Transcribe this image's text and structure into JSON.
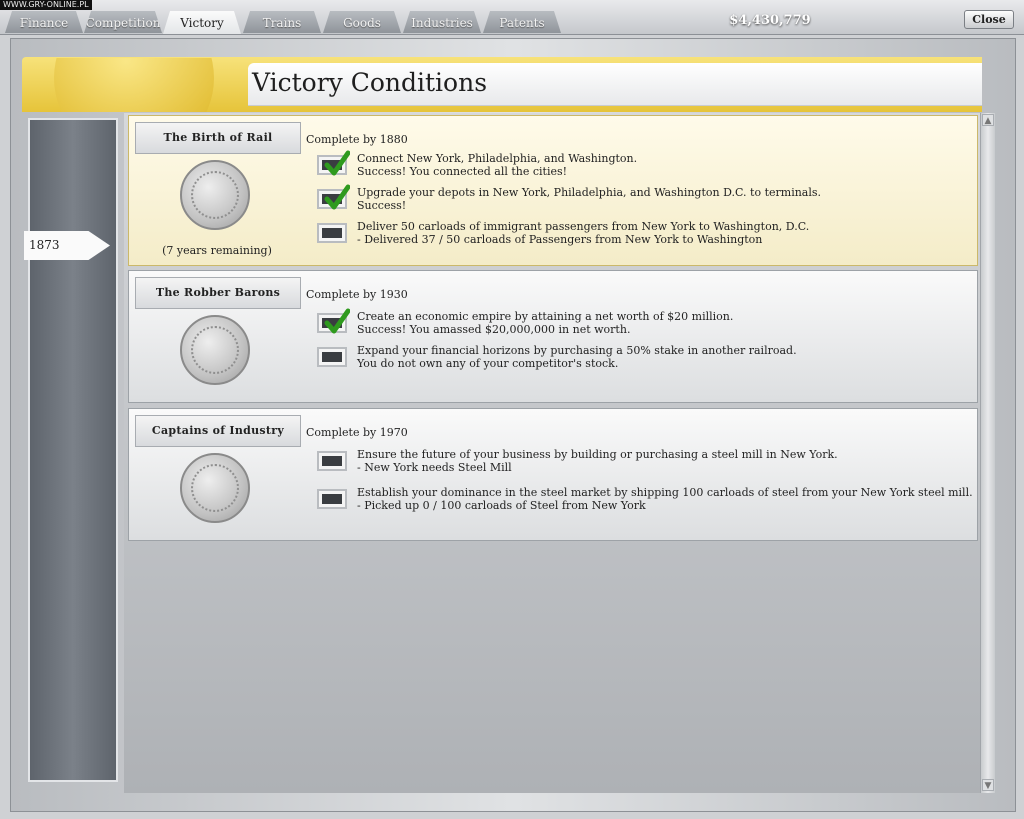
{
  "watermark": "WWW.GRY-ONLINE.PL",
  "tabs": [
    {
      "label": "Finance",
      "active": false
    },
    {
      "label": "Competition",
      "active": false
    },
    {
      "label": "Victory",
      "active": true
    },
    {
      "label": "Trains",
      "active": false
    },
    {
      "label": "Goods",
      "active": false
    },
    {
      "label": "Industries",
      "active": false
    },
    {
      "label": "Patents",
      "active": false
    }
  ],
  "money": "$4,430,779",
  "close_label": "Close",
  "page_title": "Victory Conditions",
  "current_year": "1873",
  "conditions": [
    {
      "name": "The Birth of Rail",
      "complete_by": "Complete by 1880",
      "remaining": "(7 years remaining)",
      "goals": [
        {
          "done": true,
          "text": "Connect New York, Philadelphia, and Washington.",
          "status": "Success! You connected all the cities!"
        },
        {
          "done": true,
          "text": "Upgrade your depots in New York, Philadelphia, and Washington D.C. to terminals.",
          "status": "Success!"
        },
        {
          "done": false,
          "text": "Deliver 50 carloads of immigrant passengers from New York to Washington, D.C.",
          "status": "- Delivered 37 / 50 carloads of Passengers from New York to Washington"
        }
      ]
    },
    {
      "name": "The Robber Barons",
      "complete_by": "Complete by 1930",
      "remaining": "",
      "goals": [
        {
          "done": true,
          "text": "Create an economic empire by attaining a net worth of $20 million.",
          "status": "Success! You amassed $20,000,000 in net worth."
        },
        {
          "done": false,
          "text": "Expand your financial horizons by purchasing a 50% stake in another railroad.",
          "status": "You do not own any of your competitor's stock."
        }
      ]
    },
    {
      "name": "Captains of Industry",
      "complete_by": "Complete by 1970",
      "remaining": "",
      "goals": [
        {
          "done": false,
          "text": "Ensure the future of your business by building or purchasing a steel mill in New York.",
          "status": "- New York needs Steel Mill"
        },
        {
          "done": false,
          "text": "Establish your dominance in the steel market by shipping 100 carloads of steel from your New York steel mill.",
          "status": "- Picked up 0 / 100 carloads of Steel from New York"
        }
      ]
    }
  ],
  "colors": {
    "accent_gold": "#e6c43a",
    "check_green": "#2f9a1e"
  }
}
